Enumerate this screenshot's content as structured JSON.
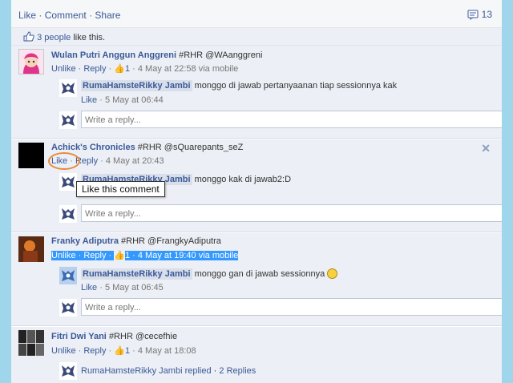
{
  "topbar": {
    "like": "Like",
    "comment": "Comment",
    "share": "Share",
    "sep": "·",
    "comments_count": "13"
  },
  "likes": {
    "count_text": "3 people",
    "suffix": "like this."
  },
  "comments": [
    {
      "author": "Wulan Putri Anggun Anggreni",
      "text": "#RHR @WAanggreni",
      "unlike": "Unlike",
      "reply": "Reply",
      "likes": "1",
      "time": "4 May at 22:58 via mobile",
      "reply_author": "RumaHamsteRikky Jambi",
      "reply_text": "monggo di jawab pertanyaanan tiap sessionnya kak",
      "reply_like": "Like",
      "reply_time": "5 May at 06:44",
      "reply_placeholder": "Write a reply..."
    },
    {
      "author": "Achick's Chronicles",
      "text": "#RHR @sQuarepants_seZ",
      "like": "Like",
      "reply": "Reply",
      "time": "4 May at 20:43",
      "reply_author": "RumaHamsteRikky Jambi",
      "reply_text": "monggo kak di jawab2:D",
      "tooltip": "Like this comment",
      "reply_placeholder": "Write a reply...",
      "close": "✕"
    },
    {
      "author": "Franky Adiputra",
      "text": "#RHR @FrangkyAdiputra",
      "unlike": "Unlike",
      "reply": "Reply",
      "likes": "1",
      "time": "4 May at 19:40 via mobile",
      "reply_author": "RumaHamsteRikky Jambi",
      "reply_text": "monggo gan di jawab sessionnya",
      "reply_like": "Like",
      "reply_time": "5 May at 06:45",
      "reply_placeholder": "Write a reply..."
    },
    {
      "author": "Fitri Dwi Yani",
      "text": "#RHR @cecefhie",
      "unlike": "Unlike",
      "reply": "Reply",
      "likes": "1",
      "time": "4 May at 18:08",
      "replied_text": "RumaHamsteRikky Jambi replied",
      "replies_link": "2 Replies"
    }
  ]
}
